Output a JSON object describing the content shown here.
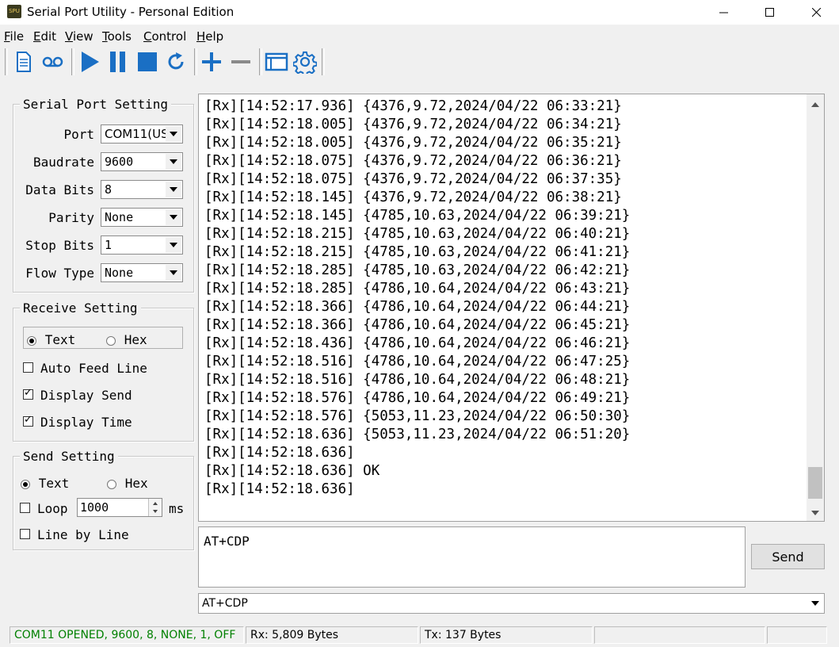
{
  "window": {
    "title": "Serial Port Utility - Personal Edition",
    "app_icon_text": "SPU"
  },
  "menu": [
    {
      "label": "File",
      "key": "F",
      "rest": "ile"
    },
    {
      "label": "Edit",
      "key": "E",
      "rest": "dit"
    },
    {
      "label": "View",
      "key": "V",
      "rest": "iew"
    },
    {
      "label": "Tools",
      "key": "T",
      "rest": "ools"
    },
    {
      "label": "Control",
      "key": "C",
      "rest": "ontrol"
    },
    {
      "label": "Help",
      "key": "H",
      "rest": "elp"
    }
  ],
  "toolbar": {
    "icons": [
      "document-icon",
      "record-icon",
      "play-icon",
      "pause-icon",
      "stop-icon",
      "refresh-icon",
      "plus-icon",
      "minus-icon",
      "window-icon",
      "gear-icon"
    ],
    "accent": "#1a6fc4"
  },
  "serial_port_setting": {
    "title": "Serial Port Setting",
    "fields": [
      {
        "label": "Port",
        "value": "COM11(US"
      },
      {
        "label": "Baudrate",
        "value": "9600"
      },
      {
        "label": "Data Bits",
        "value": "8"
      },
      {
        "label": "Parity",
        "value": "None"
      },
      {
        "label": "Stop Bits",
        "value": "1"
      },
      {
        "label": "Flow Type",
        "value": "None"
      }
    ]
  },
  "receive_setting": {
    "title": "Receive Setting",
    "text_label": "Text",
    "hex_label": "Hex",
    "selected": "Text",
    "auto_feed_line": {
      "label": "Auto Feed Line",
      "checked": false
    },
    "display_send": {
      "label": "Display Send",
      "checked": true
    },
    "display_time": {
      "label": "Display Time",
      "checked": true
    }
  },
  "send_setting": {
    "title": "Send Setting",
    "text_label": "Text",
    "hex_label": "Hex",
    "selected": "Text",
    "loop": {
      "label": "Loop",
      "checked": false,
      "value": "1000",
      "unit": "ms"
    },
    "line_by_line": {
      "label": "Line by Line",
      "checked": false
    }
  },
  "receive_lines": [
    "[Rx][14:52:17.936] {4376,9.72,2024/04/22 06:33:21}",
    "[Rx][14:52:18.005] {4376,9.72,2024/04/22 06:34:21}",
    "[Rx][14:52:18.005] {4376,9.72,2024/04/22 06:35:21}",
    "[Rx][14:52:18.075] {4376,9.72,2024/04/22 06:36:21}",
    "[Rx][14:52:18.075] {4376,9.72,2024/04/22 06:37:35}",
    "[Rx][14:52:18.145] {4376,9.72,2024/04/22 06:38:21}",
    "[Rx][14:52:18.145] {4785,10.63,2024/04/22 06:39:21}",
    "[Rx][14:52:18.215] {4785,10.63,2024/04/22 06:40:21}",
    "[Rx][14:52:18.215] {4785,10.63,2024/04/22 06:41:21}",
    "[Rx][14:52:18.285] {4785,10.63,2024/04/22 06:42:21}",
    "[Rx][14:52:18.285] {4786,10.64,2024/04/22 06:43:21}",
    "[Rx][14:52:18.366] {4786,10.64,2024/04/22 06:44:21}",
    "[Rx][14:52:18.366] {4786,10.64,2024/04/22 06:45:21}",
    "[Rx][14:52:18.436] {4786,10.64,2024/04/22 06:46:21}",
    "[Rx][14:52:18.516] {4786,10.64,2024/04/22 06:47:25}",
    "[Rx][14:52:18.516] {4786,10.64,2024/04/22 06:48:21}",
    "[Rx][14:52:18.576] {4786,10.64,2024/04/22 06:49:21}",
    "[Rx][14:52:18.576] {5053,11.23,2024/04/22 06:50:30}",
    "[Rx][14:52:18.636] {5053,11.23,2024/04/22 06:51:20}",
    "[Rx][14:52:18.636]",
    "[Rx][14:52:18.636] OK",
    "[Rx][14:52:18.636]"
  ],
  "send": {
    "text": "AT+CDP",
    "button_label": "Send",
    "history_value": "AT+CDP"
  },
  "status": {
    "connection": "COM11 OPENED, 9600, 8, NONE, 1, OFF",
    "connection_color": "#008000",
    "rx": "Rx: 5,809 Bytes",
    "tx": "Tx: 137 Bytes"
  }
}
